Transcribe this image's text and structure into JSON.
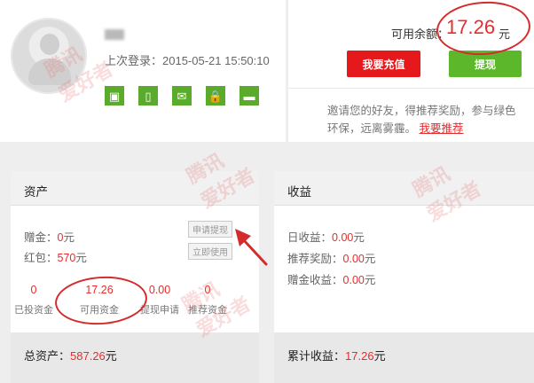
{
  "profile": {
    "last_login_label": "上次登录：",
    "last_login_value": "2015-05-21 15:50:10",
    "verify_icons": [
      {
        "name": "id-card-icon",
        "glyph": "▣"
      },
      {
        "name": "phone-icon",
        "glyph": "▯"
      },
      {
        "name": "email-icon",
        "glyph": "✉"
      },
      {
        "name": "lock-icon",
        "glyph": "🔒"
      },
      {
        "name": "bank-card-icon",
        "glyph": "▬"
      }
    ]
  },
  "balance": {
    "label": "可用余额：",
    "value": "17.26",
    "unit": "元",
    "recharge_label": "我要充值",
    "withdraw_label": "提现"
  },
  "invite": {
    "text": "邀请您的好友，得推荐奖励，参与绿色环保，远离雾霾。",
    "link": "我要推荐"
  },
  "assets": {
    "title": "资产",
    "bonus_label": "赠金：",
    "bonus_value": "0",
    "bonus_unit": "元",
    "redpacket_label": "红包：",
    "redpacket_value": "570",
    "redpacket_unit": "元",
    "apply_withdraw_btn": "申请提现",
    "use_now_btn": "立即使用",
    "stats": [
      {
        "value": "0",
        "label": "已投资金"
      },
      {
        "value": "17.26",
        "label": "可用资金"
      },
      {
        "value": "0.00",
        "label": "提现申请"
      },
      {
        "value": "0",
        "label": "推荐资金"
      }
    ],
    "total_label": "总资产：",
    "total_value": "587.26",
    "total_unit": "元"
  },
  "earnings": {
    "title": "收益",
    "daily_label": "日收益：",
    "daily_value": "0.00",
    "daily_unit": "元",
    "referral_label": "推荐奖励：",
    "referral_value": "0.00",
    "referral_unit": "元",
    "bonus_label": "赠金收益：",
    "bonus_value": "0.00",
    "bonus_unit": "元",
    "cumulative_label": "累计收益：",
    "cumulative_value": "17.26",
    "cumulative_unit": "元"
  },
  "colors": {
    "accent_red": "#e52d2d",
    "accent_green": "#5cb82a",
    "annotation": "#d42c2c"
  }
}
